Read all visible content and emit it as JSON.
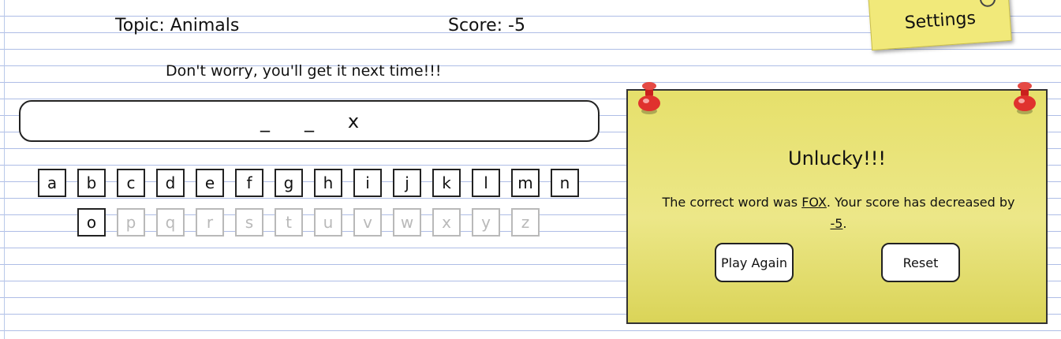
{
  "header": {
    "topic": "Topic: Animals",
    "score": "Score: -5",
    "settings_label": "Settings"
  },
  "message": "Don't worry, you'll get it next time!!!",
  "word": [
    "_",
    "_",
    "x"
  ],
  "keyboard": {
    "row1": [
      "a",
      "b",
      "c",
      "d",
      "e",
      "f",
      "g",
      "h",
      "i",
      "j",
      "k",
      "l",
      "m",
      "n"
    ],
    "row2": [
      "o",
      "p",
      "q",
      "r",
      "s",
      "t",
      "u",
      "v",
      "w",
      "x",
      "y",
      "z"
    ],
    "used_letters": [
      "p",
      "q",
      "r",
      "s",
      "t",
      "u",
      "v",
      "w",
      "x",
      "y",
      "z"
    ]
  },
  "popup": {
    "title": "Unlucky!!!",
    "text_before": "The correct word was ",
    "answer": "FOX",
    "text_middle": ". Your score has decreased by ",
    "penalty": "-5",
    "text_end": ".",
    "play_again_label": "Play Again",
    "reset_label": "Reset"
  },
  "colors": {
    "note_yellow": "#e6e06b",
    "pin_red": "#e0322e",
    "used_key_gray": "#b9b9b9",
    "ruled_line_blue": "#aebde6"
  },
  "icons": {
    "settings": "gear-icon",
    "pins": "pushpin-icon"
  }
}
